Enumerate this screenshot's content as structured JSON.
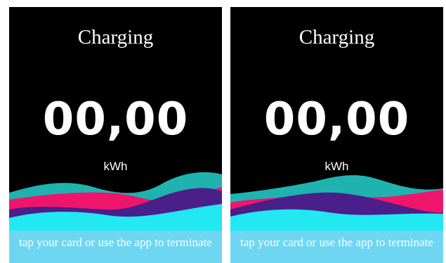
{
  "colors": {
    "background": "#000000",
    "teal": "#1fb3b0",
    "pink": "#f0156c",
    "purple": "#4a1f8a",
    "cyan": "#22e8f2",
    "footer": "#6fd6f2"
  },
  "screens": [
    {
      "title": "Charging",
      "energy_value": "00,00",
      "energy_unit": "kWh",
      "footer_message": "tap your card or use the app to terminate"
    },
    {
      "title": "Charging",
      "energy_value": "00,00",
      "energy_unit": "kWh",
      "footer_message": "tap your card or use the app to terminate"
    }
  ]
}
